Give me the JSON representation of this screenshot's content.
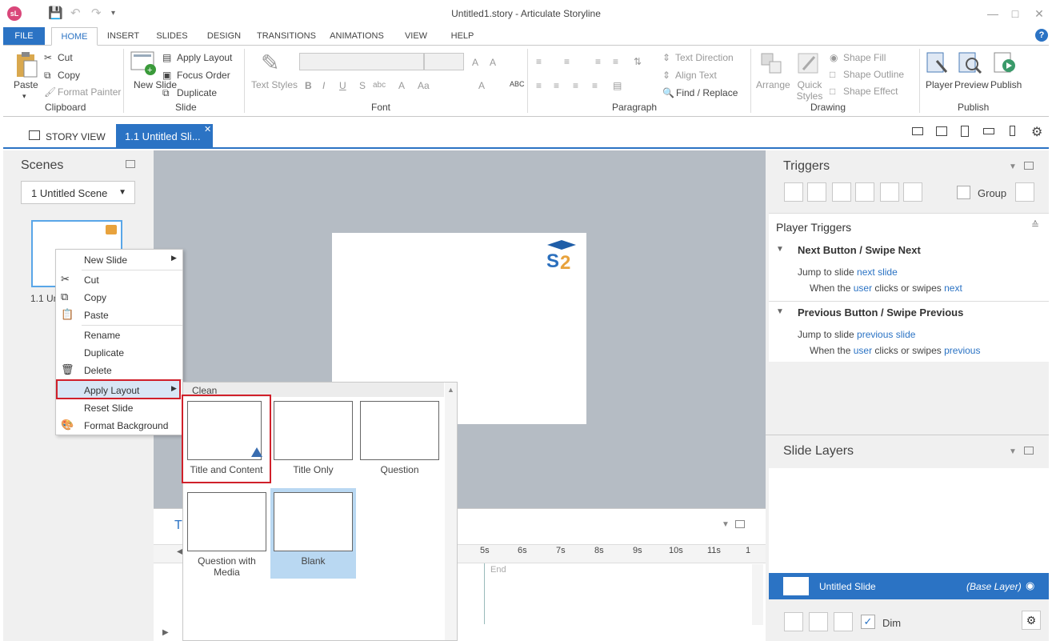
{
  "title_bar": {
    "title": "Untitled1.story - Articulate Storyline",
    "logo": "sL"
  },
  "ribbon_tabs": [
    "FILE",
    "HOME",
    "INSERT",
    "SLIDES",
    "DESIGN",
    "TRANSITIONS",
    "ANIMATIONS",
    "VIEW",
    "HELP"
  ],
  "clipboard": {
    "paste": "Paste",
    "cut": "Cut",
    "copy": "Copy",
    "format_painter": "Format Painter",
    "label": "Clipboard"
  },
  "slide_group": {
    "new_slide": "New Slide",
    "apply_layout": "Apply Layout",
    "focus_order": "Focus Order",
    "duplicate": "Duplicate",
    "label": "Slide"
  },
  "font_group": {
    "text_styles": "Text Styles",
    "label": "Font"
  },
  "paragraph_group": {
    "text_direction": "Text Direction",
    "align_text": "Align Text",
    "find_replace": "Find / Replace",
    "label": "Paragraph"
  },
  "drawing_group": {
    "arrange": "Arrange",
    "quick_styles": "Quick Styles",
    "shape_fill": "Shape Fill",
    "shape_outline": "Shape Outline",
    "shape_effect": "Shape Effect",
    "label": "Drawing"
  },
  "publish_group": {
    "player": "Player",
    "preview": "Preview",
    "publish": "Publish",
    "label": "Publish"
  },
  "doc_tabs": {
    "story_view": "STORY VIEW",
    "slide_tab": "1.1 Untitled Sli..."
  },
  "scenes": {
    "title": "Scenes",
    "dropdown": "1 Untitled Scene",
    "slide_label": "1.1 Un"
  },
  "context_menu": {
    "items": [
      "New Slide",
      "Cut",
      "Copy",
      "Paste",
      "Rename",
      "Duplicate",
      "Delete",
      "Apply Layout",
      "Reset Slide",
      "Format Background"
    ]
  },
  "layouts": {
    "header": "Clean",
    "items": [
      "Title and Content",
      "Title Only",
      "Question",
      "Question with Media",
      "Blank"
    ]
  },
  "timeline": {
    "title": "T",
    "ticks": [
      "5s",
      "6s",
      "7s",
      "8s",
      "9s",
      "10s",
      "11s",
      "1"
    ],
    "end": "End"
  },
  "triggers": {
    "title": "Triggers",
    "group": "Group",
    "player_triggers": "Player Triggers",
    "next": {
      "heading": "Next Button / Swipe Next",
      "jump": "Jump to slide",
      "target": "next slide",
      "when": "When the",
      "actor": "user",
      "verb": "clicks or swipes",
      "event": "next"
    },
    "prev": {
      "heading": "Previous Button / Swipe Previous",
      "jump": "Jump to slide",
      "target": "previous slide",
      "when": "When the",
      "actor": "user",
      "verb": "clicks or swipes",
      "event": "previous"
    }
  },
  "layers": {
    "title": "Slide Layers",
    "base_name": "Untitled Slide",
    "base_tag": "(Base Layer)",
    "dim": "Dim"
  }
}
